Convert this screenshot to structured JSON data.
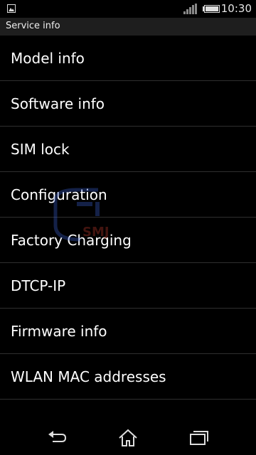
{
  "status_bar": {
    "time": "10:30",
    "icons": [
      "image-notification-icon",
      "signal-icon",
      "battery-icon"
    ]
  },
  "header": {
    "title": "Service info"
  },
  "menu": {
    "items": [
      {
        "label": "Model info"
      },
      {
        "label": "Software info"
      },
      {
        "label": "SIM lock"
      },
      {
        "label": "Configuration"
      },
      {
        "label": "Factory Charging"
      },
      {
        "label": "DTCP-IP"
      },
      {
        "label": "Firmware info"
      },
      {
        "label": "WLAN MAC addresses"
      }
    ]
  },
  "watermark": {
    "text": "SMJ"
  },
  "navigation": {
    "buttons": [
      "back-icon",
      "home-icon",
      "recent-apps-icon"
    ]
  },
  "colors": {
    "background": "#000000",
    "header_background": "#1e1e1e",
    "divider": "#2f2f2f",
    "text": "#ffffff"
  }
}
